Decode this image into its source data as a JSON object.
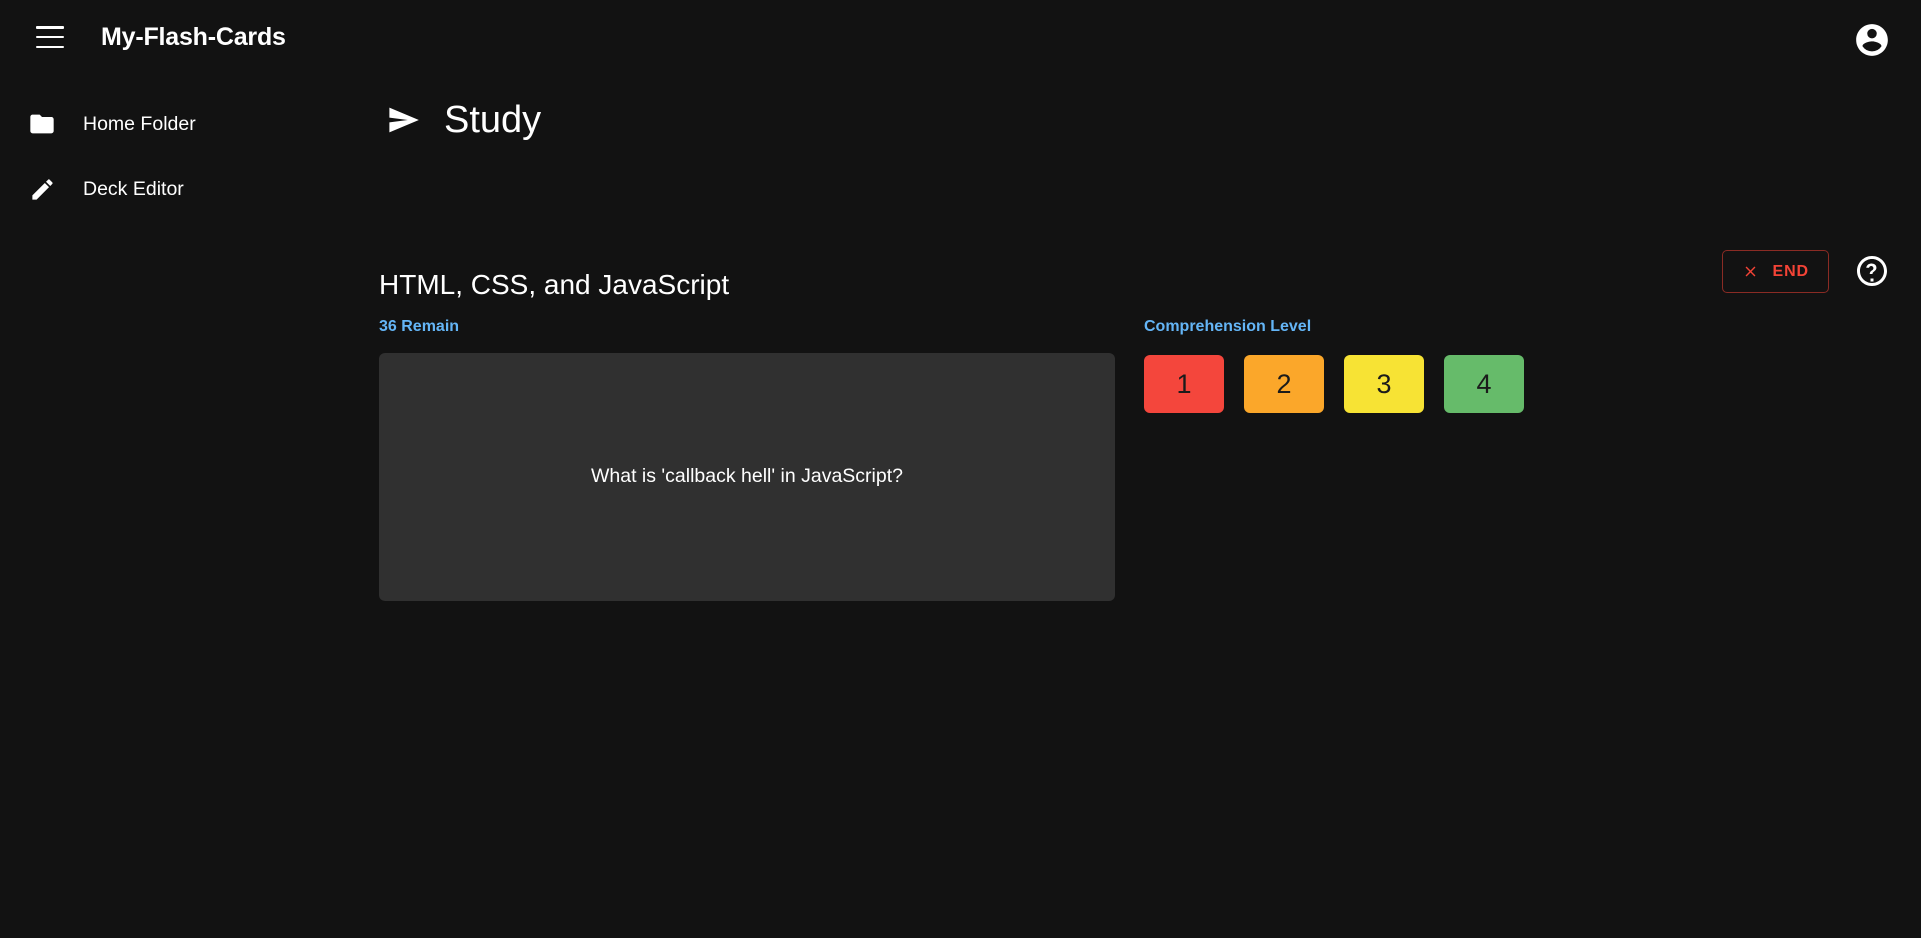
{
  "app": {
    "title": "My-Flash-Cards",
    "background_color": "#121212",
    "menu_icon": "hamburger-menu-icon",
    "avatar_icon": "account-circle-icon"
  },
  "sidebar": {
    "items": [
      {
        "label": "Home Folder",
        "icon": "folder-icon"
      },
      {
        "label": "Deck Editor",
        "icon": "pencil-edit-icon"
      }
    ]
  },
  "main": {
    "page_icon": "send-arrow-icon",
    "page_title": "Study",
    "deck_title": "HTML, CSS, and JavaScript",
    "end_button": {
      "label": "END",
      "icon": "close-x-icon",
      "color": "#f44336"
    },
    "help_icon": "help-circle-icon"
  },
  "study": {
    "remain_label": "36 Remain",
    "remain_count": 36,
    "accent_color": "#64b5f6",
    "card": {
      "text": "What is 'callback hell' in JavaScript?",
      "background_color": "#303030"
    },
    "comprehension": {
      "label": "Comprehension Level",
      "levels": [
        {
          "value": "1",
          "color": "#f4463c"
        },
        {
          "value": "2",
          "color": "#fba72a"
        },
        {
          "value": "3",
          "color": "#f7e334"
        },
        {
          "value": "4",
          "color": "#66bb6a"
        }
      ]
    }
  }
}
